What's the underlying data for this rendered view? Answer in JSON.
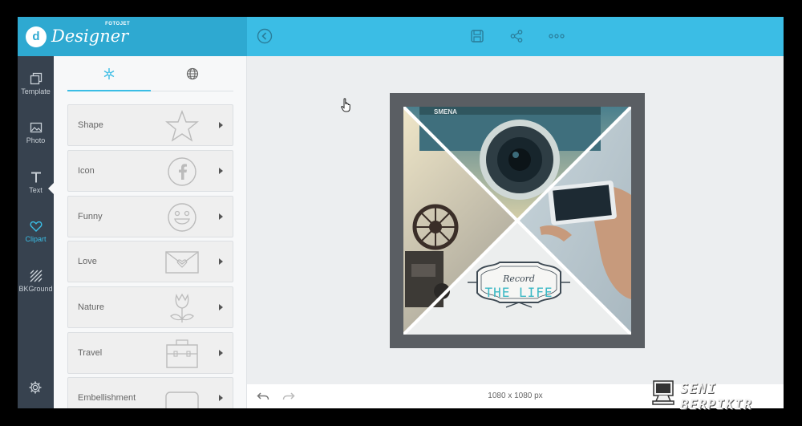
{
  "brand": {
    "name": "Designer",
    "sub": "FOTOJET",
    "mark": "d"
  },
  "rail": {
    "items": [
      {
        "label": "Template",
        "icon": "template-icon"
      },
      {
        "label": "Photo",
        "icon": "photo-icon"
      },
      {
        "label": "Text",
        "icon": "text-icon"
      },
      {
        "label": "Clipart",
        "icon": "heart-icon",
        "active": true
      },
      {
        "label": "BKGround",
        "icon": "background-icon"
      }
    ],
    "settings_icon": "gear-icon"
  },
  "panel": {
    "tabs": [
      {
        "icon": "snowflake-icon",
        "active": true
      },
      {
        "icon": "globe-icon",
        "active": false
      }
    ],
    "categories": [
      {
        "label": "Shape",
        "art": "star"
      },
      {
        "label": "Icon",
        "art": "facebook-circle"
      },
      {
        "label": "Funny",
        "art": "smiley"
      },
      {
        "label": "Love",
        "art": "love-envelope"
      },
      {
        "label": "Nature",
        "art": "tulip"
      },
      {
        "label": "Travel",
        "art": "suitcase"
      },
      {
        "label": "Embellishment",
        "art": "frame"
      }
    ]
  },
  "toolbar": {
    "icons": [
      "back-icon",
      "save-icon",
      "share-icon",
      "more-icon"
    ]
  },
  "canvas": {
    "badge_top": "Record",
    "badge_main": "THE LIFE",
    "camera_text": "SMENA"
  },
  "bottombar": {
    "size": "1080 x 1080 px"
  },
  "watermark": {
    "text": "SENI BERPIKIR"
  },
  "colors": {
    "accent": "#3bbde5",
    "accent_dark": "#2ea9d1",
    "rail": "#37424f",
    "frame": "#5a5e63"
  }
}
